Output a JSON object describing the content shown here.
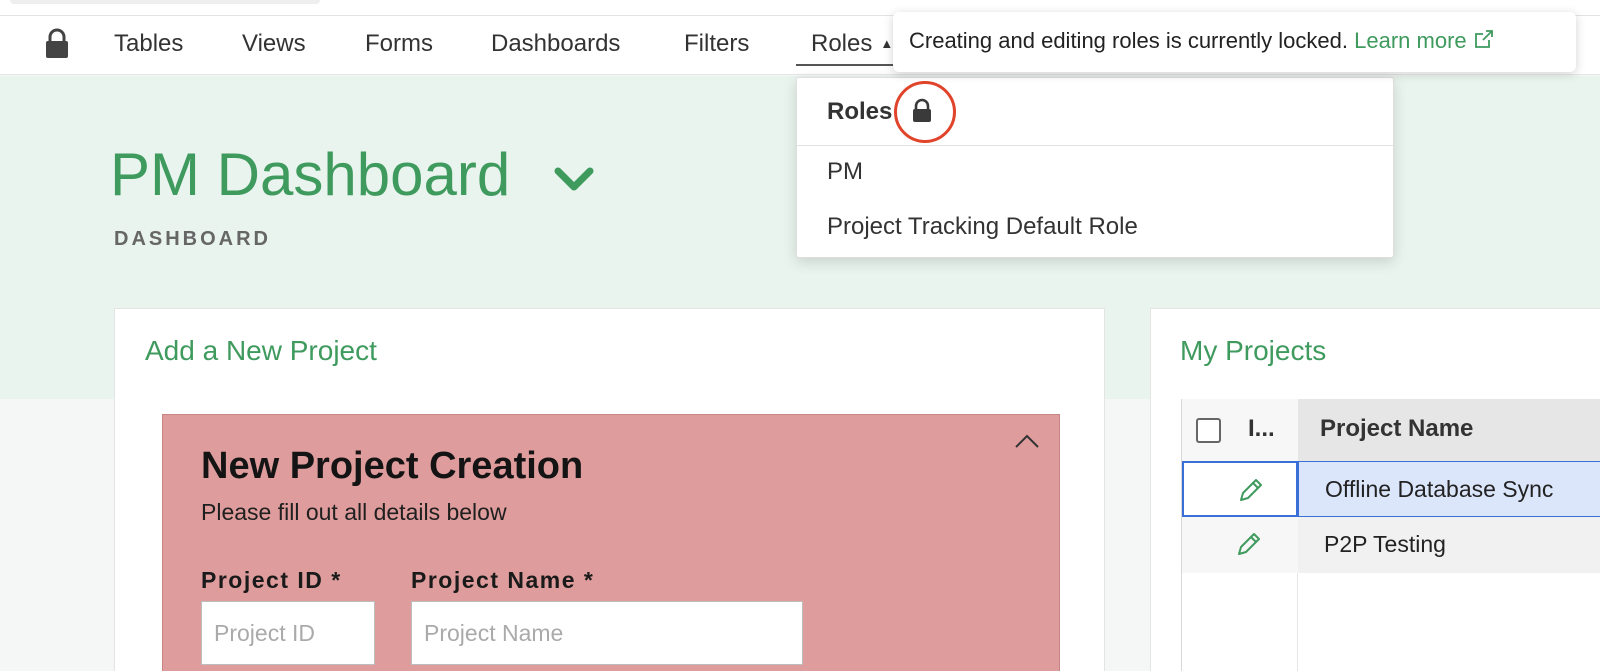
{
  "nav": {
    "items": [
      {
        "label": "Tables"
      },
      {
        "label": "Views"
      },
      {
        "label": "Forms"
      },
      {
        "label": "Dashboards"
      },
      {
        "label": "Filters"
      },
      {
        "label": "Roles"
      }
    ],
    "active_index": 5
  },
  "tooltip": {
    "message": "Creating and editing roles is currently locked.",
    "link_label": "Learn more"
  },
  "roles_dropdown": {
    "header": "Roles",
    "items": [
      "PM",
      "Project Tracking Default Role"
    ]
  },
  "page": {
    "title": "PM Dashboard",
    "subtitle": "DASHBOARD"
  },
  "add_project_card": {
    "title": "Add a New Project",
    "form": {
      "heading": "New Project Creation",
      "subheading": "Please fill out all details below",
      "fields": [
        {
          "label": "Project ID *",
          "placeholder": "Project ID",
          "value": ""
        },
        {
          "label": "Project Name *",
          "placeholder": "Project Name",
          "value": ""
        }
      ]
    }
  },
  "my_projects_card": {
    "title": "My Projects",
    "columns": [
      "I...",
      "Project Name"
    ],
    "rows": [
      {
        "project_name": "Offline Database Sync",
        "selected": true
      },
      {
        "project_name": "P2P Testing",
        "selected": false
      }
    ]
  },
  "colors": {
    "brand_green": "#3f9a5e",
    "hero_bg": "#e9f4ee",
    "form_panel_bg": "#df9c9c",
    "selection_blue": "#3a6fd8",
    "highlight_red": "#e0442a"
  }
}
